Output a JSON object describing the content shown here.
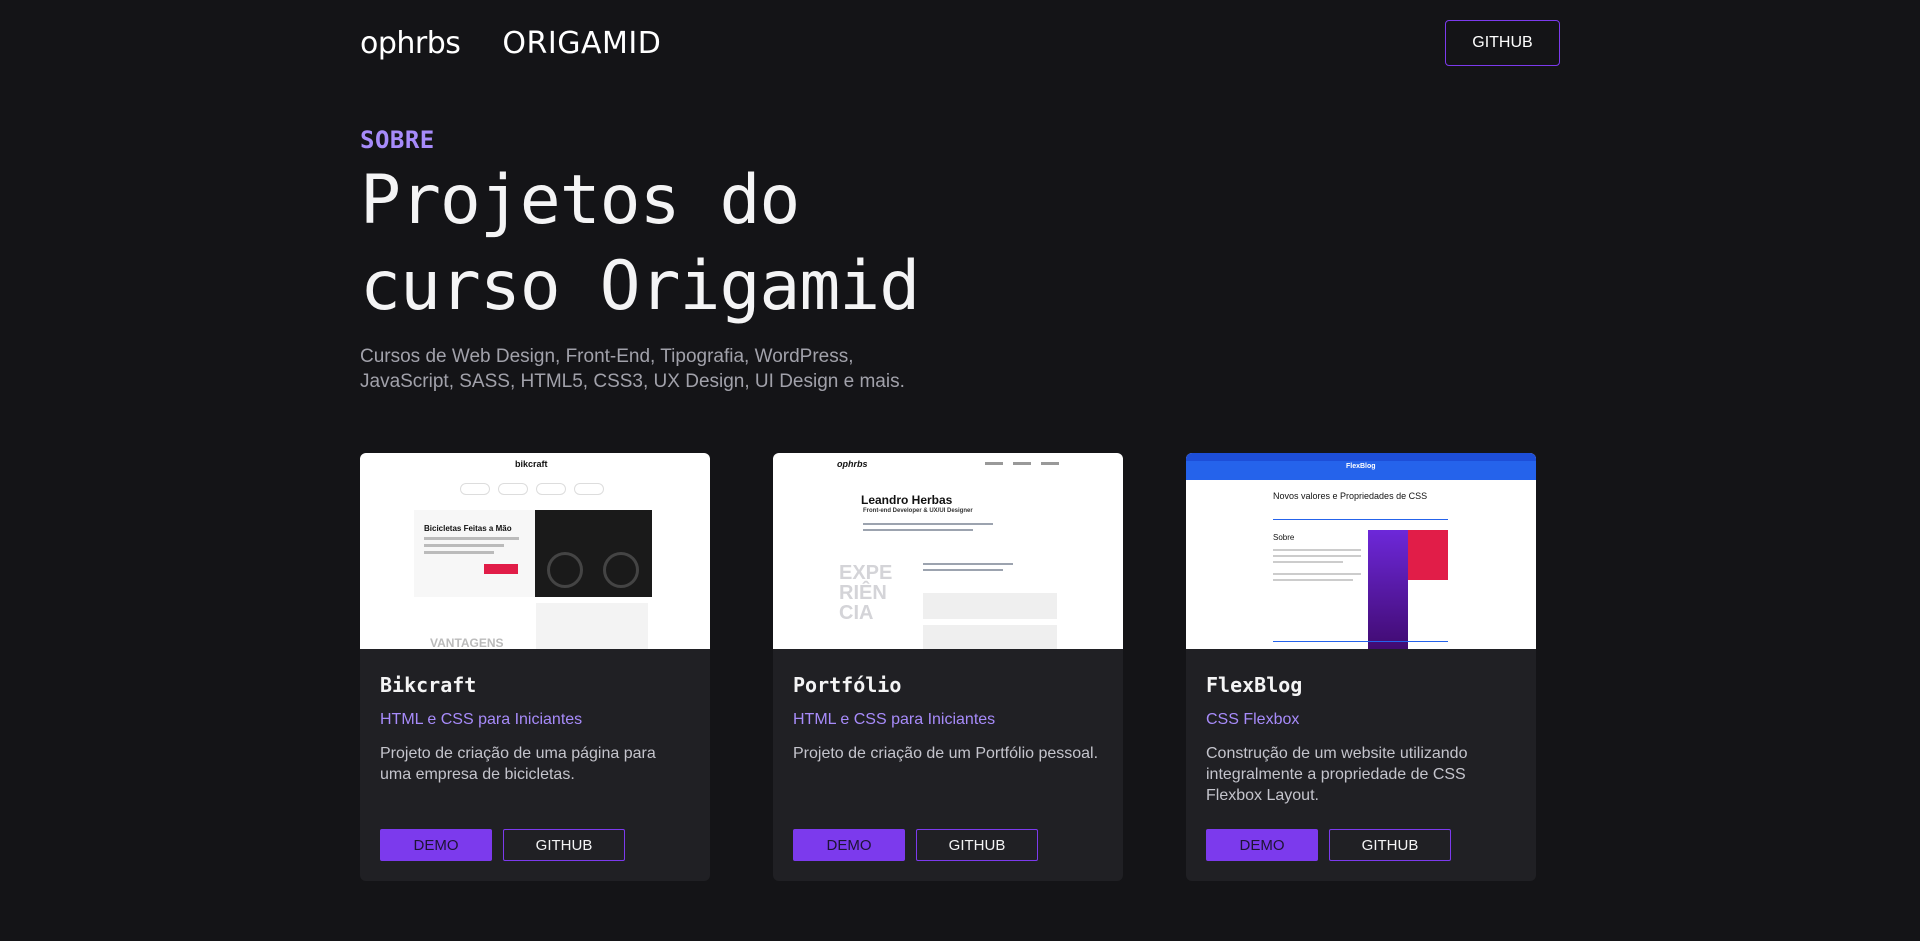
{
  "header": {
    "logo_text": "ophrbs",
    "partner_logo_text": "ORIGAMID",
    "github_label": "GITHUB"
  },
  "hero": {
    "eyebrow": "SOBRE",
    "title": "Projetos do curso Origamid",
    "subtitle": "Cursos de Web Design, Front-End, Tipografia, WordPress, JavaScript, SASS, HTML5, CSS3, UX Design, UI Design e mais."
  },
  "colors": {
    "background": "#141417",
    "card": "#202024",
    "accent": "#7c3aed",
    "accent_text": "#a78bfa"
  },
  "projects": [
    {
      "title": "Bikcraft",
      "course": "HTML e CSS para Iniciantes",
      "description": "Projeto de criação de uma página para uma empresa de bicicletas.",
      "demo_label": "DEMO",
      "github_label": "GITHUB",
      "thumb": {
        "logo": "bikcraft",
        "headline": "Bicicletas Feitas a Mão",
        "section": "VANTAGENS"
      }
    },
    {
      "title": "Portfólio",
      "course": "HTML e CSS para Iniciantes",
      "description": "Projeto de criação de um Portfólio pessoal.",
      "demo_label": "DEMO",
      "github_label": "GITHUB",
      "thumb": {
        "logo": "ophrbs",
        "name": "Leandro Herbas",
        "role": "Front-end Developer & UX/UI Designer",
        "section": "EXPE RIÊN CIA"
      }
    },
    {
      "title": "FlexBlog",
      "course": "CSS Flexbox",
      "description": "Construção de um website utilizando integralmente a propriedade de CSS Flexbox Layout.",
      "demo_label": "DEMO",
      "github_label": "GITHUB",
      "thumb": {
        "logo": "FlexBlog",
        "heading": "Novos valores e Propriedades de CSS",
        "section": "Sobre"
      }
    }
  ]
}
